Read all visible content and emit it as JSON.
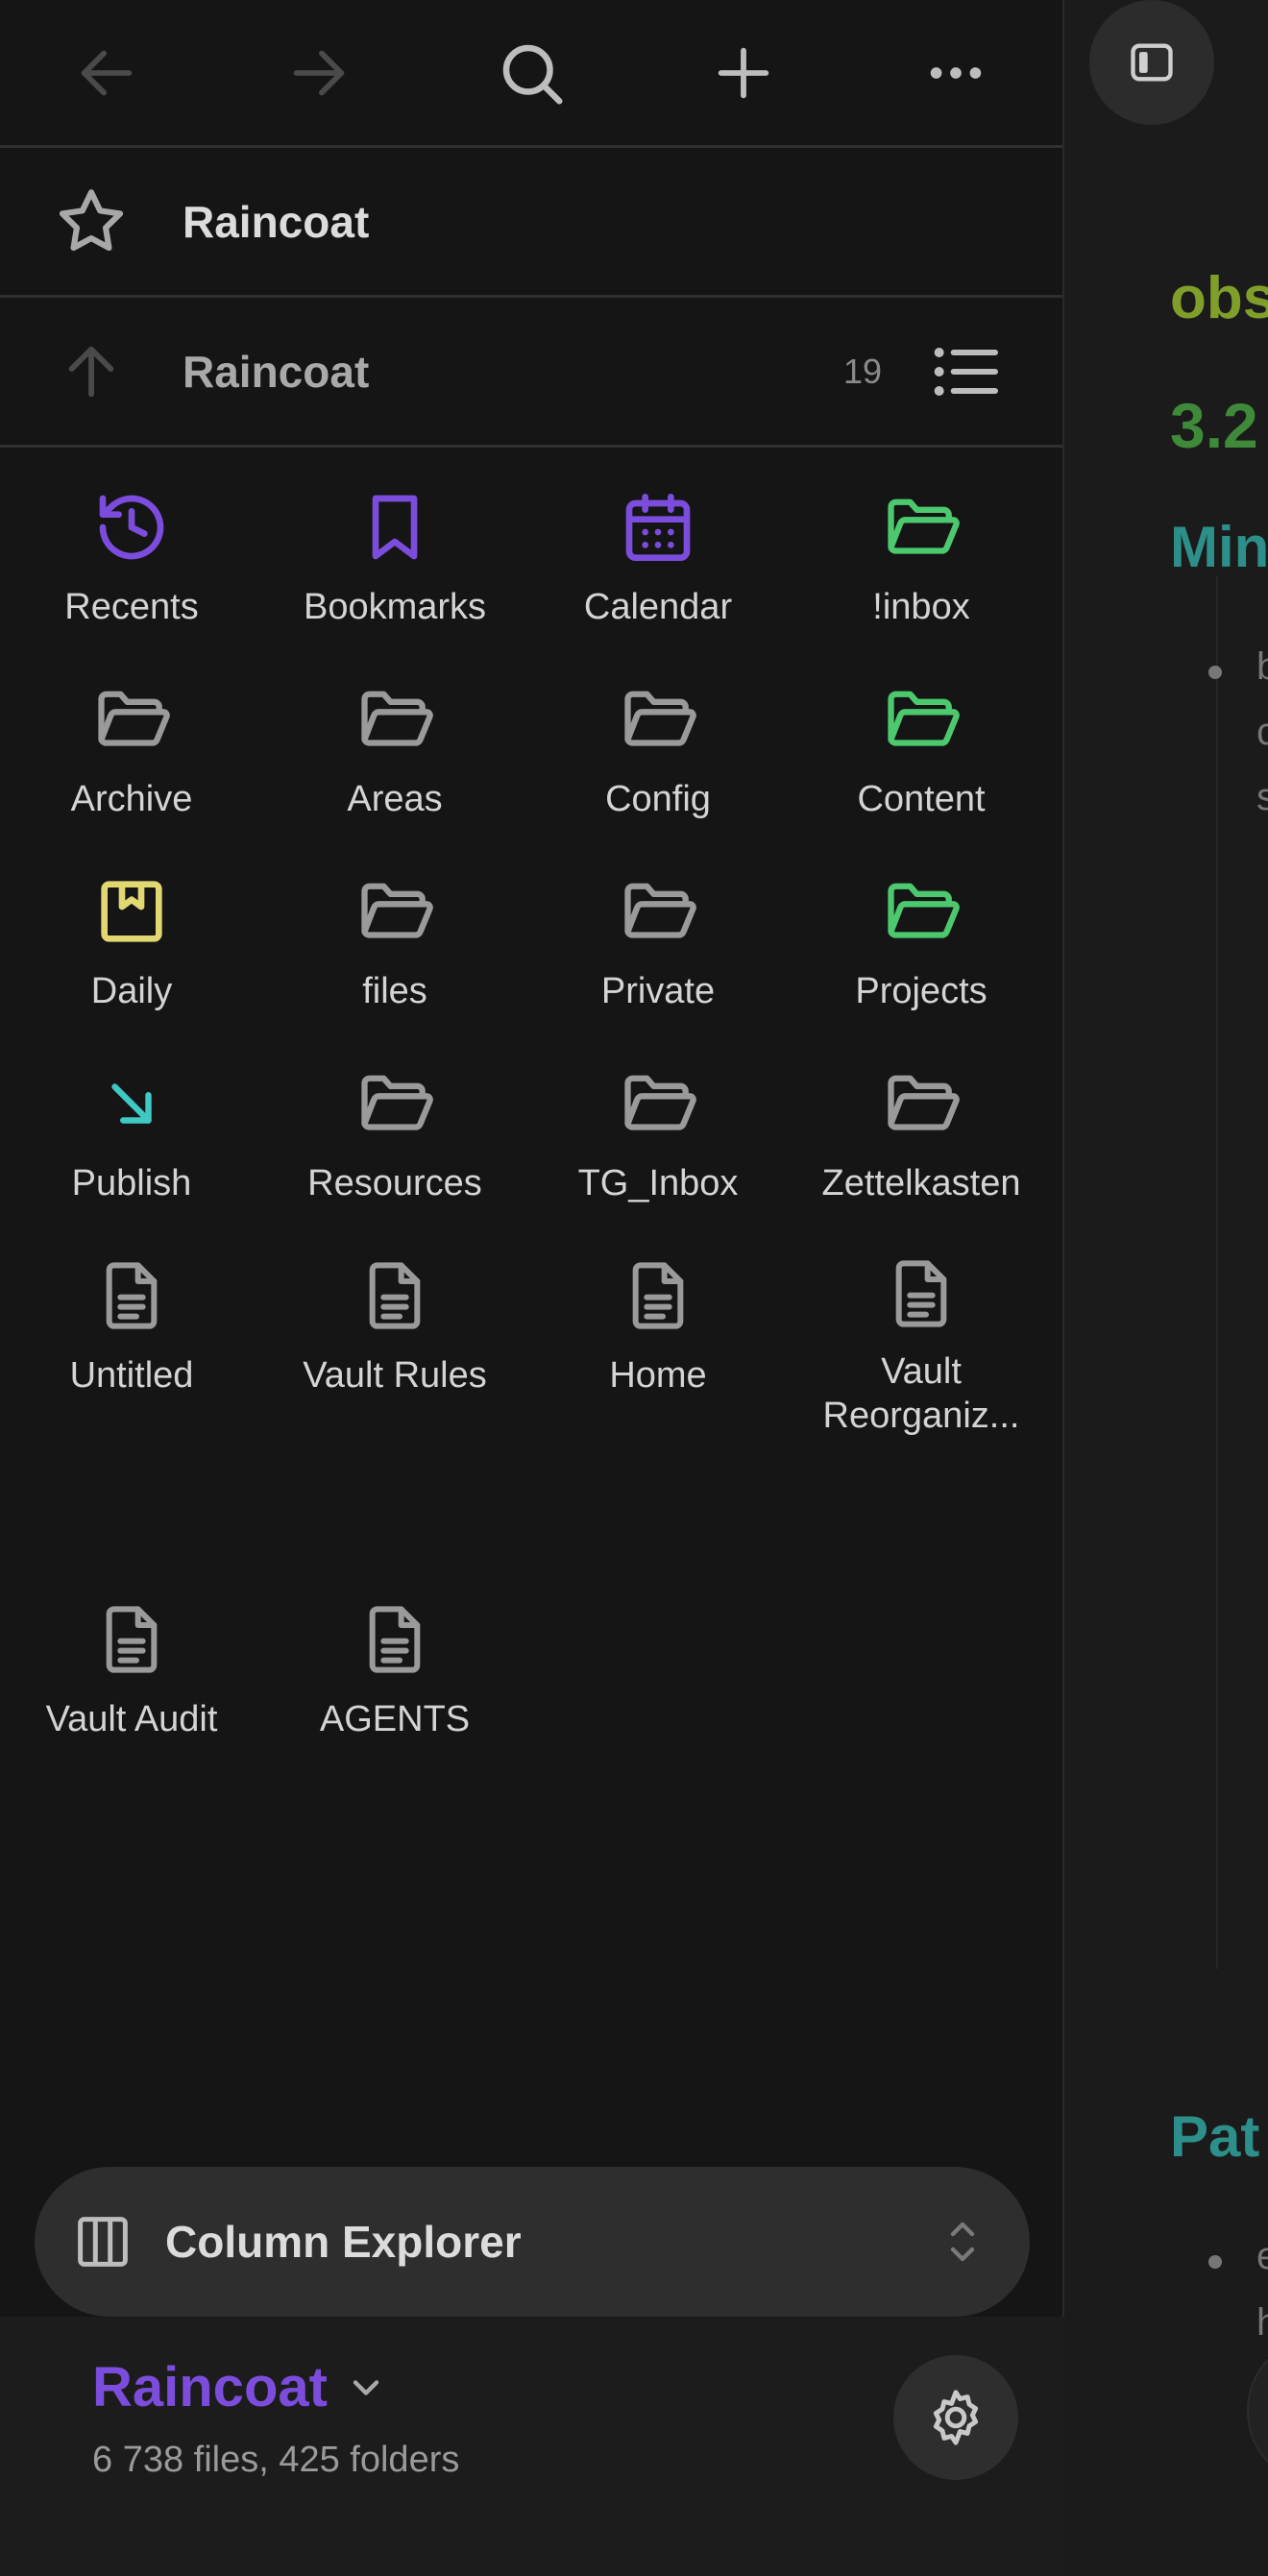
{
  "toolbar": {
    "back_icon": "arrow-left-icon",
    "forward_icon": "arrow-right-icon",
    "search_icon": "search-icon",
    "new_icon": "plus-icon",
    "more_icon": "more-horizontal-icon"
  },
  "favorites": {
    "label": "Raincoat",
    "icon": "star-icon"
  },
  "nav": {
    "label": "Raincoat",
    "count": "19",
    "up_icon": "arrow-up-icon",
    "list_icon": "list-icon"
  },
  "items": [
    {
      "label": "Recents",
      "icon": "history-icon",
      "color": "#7c4ddc"
    },
    {
      "label": "Bookmarks",
      "icon": "bookmark-icon",
      "color": "#7c4ddc"
    },
    {
      "label": "Calendar",
      "icon": "calendar-icon",
      "color": "#7c4ddc"
    },
    {
      "label": "!inbox",
      "icon": "folder-open-icon",
      "color": "#4cc96f"
    },
    {
      "label": "Archive",
      "icon": "folder-open-icon",
      "color": "#9a9a9a"
    },
    {
      "label": "Areas",
      "icon": "folder-open-icon",
      "color": "#9a9a9a"
    },
    {
      "label": "Config",
      "icon": "folder-open-icon",
      "color": "#9a9a9a"
    },
    {
      "label": "Content",
      "icon": "folder-open-icon",
      "color": "#4cc96f"
    },
    {
      "label": "Daily",
      "icon": "daily-note-icon",
      "color": "#e2d872"
    },
    {
      "label": "files",
      "icon": "folder-open-icon",
      "color": "#9a9a9a"
    },
    {
      "label": "Private",
      "icon": "folder-open-icon",
      "color": "#9a9a9a"
    },
    {
      "label": "Projects",
      "icon": "folder-open-icon",
      "color": "#4cc96f"
    },
    {
      "label": "Publish",
      "icon": "arrow-down-right-icon",
      "color": "#3fc9c4"
    },
    {
      "label": "Resources",
      "icon": "folder-open-icon",
      "color": "#9a9a9a"
    },
    {
      "label": "TG_Inbox",
      "icon": "folder-open-icon",
      "color": "#9a9a9a"
    },
    {
      "label": "Zettelkasten",
      "icon": "folder-open-icon",
      "color": "#9a9a9a"
    },
    {
      "label": "Untitled",
      "icon": "file-text-icon",
      "color": "#9a9a9a"
    },
    {
      "label": "Vault Rules",
      "icon": "file-text-icon",
      "color": "#9a9a9a"
    },
    {
      "label": "Home",
      "icon": "file-text-icon",
      "color": "#9a9a9a"
    },
    {
      "label": "Vault\nReorganiz...",
      "icon": "file-text-icon",
      "color": "#9a9a9a"
    },
    {
      "label": "Vault Audit",
      "icon": "file-text-icon",
      "color": "#9a9a9a"
    },
    {
      "label": "AGENTS",
      "icon": "file-text-icon",
      "color": "#9a9a9a"
    }
  ],
  "view_switcher": {
    "label": "Column Explorer",
    "icon": "columns-icon",
    "chevron_icon": "chevrons-up-down-icon"
  },
  "vault": {
    "name": "Raincoat",
    "stats": "6 738 files, 425 folders",
    "settings_icon": "gear-icon"
  },
  "editor": {
    "fragments": [
      "obs",
      "3.2",
      "Min",
      "Pat"
    ],
    "text_fragments": [
      "b",
      "c",
      "s",
      "e",
      "h"
    ],
    "sidebar_icon": "sidebar-toggle-icon"
  },
  "colors": {
    "accent": "#7c4ddc",
    "folder_green": "#4cc96f",
    "daily_yellow": "#e2d872",
    "publish_cyan": "#3fc9c4"
  }
}
